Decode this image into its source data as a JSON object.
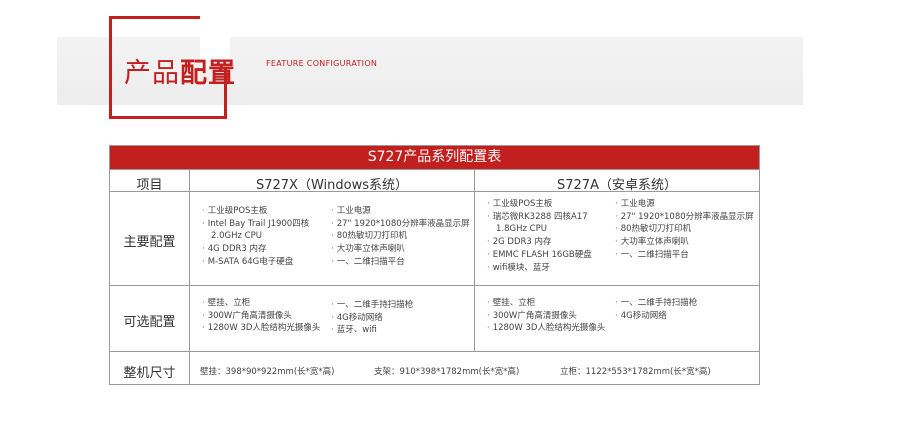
{
  "header": {
    "title_light": "产品",
    "title_bold": "配置",
    "subtitle_en": "FEATURE CONFIGURATION"
  },
  "table": {
    "title": "S727产品系列配置表",
    "col_item": "项目",
    "col_windows": "S727X（Windows系统）",
    "col_android": "S727A（安卓系统）",
    "row_main": "主要配置",
    "row_optional": "可选配置",
    "row_size": "整机尺寸",
    "win_main_left": [
      "工业级POS主板",
      "Intel Bay Trail J1900四核",
      "2.0GHz CPU",
      "4G DDR3 内存",
      "M-SATA 64G电子硬盘"
    ],
    "win_main_right": [
      "工业电源",
      "27\" 1920*1080分辨率液晶显示屏",
      "80热敏切刀打印机",
      "大功率立体声喇叭",
      "一、二维扫描平台"
    ],
    "and_main_left": [
      "工业级POS主板",
      "瑞芯微RK3288 四核A17",
      "1.8GHz CPU",
      "2G DDR3 内存",
      "EMMC FLASH 16GB硬盘",
      "wifi模块、蓝牙"
    ],
    "and_main_right": [
      "工业电源",
      "27\" 1920*1080分辨率液晶显示屏",
      "80热敏切刀打印机",
      "大功率立体声喇叭",
      "一、二维扫描平台"
    ],
    "win_opt_left": [
      "壁挂、立柜",
      "300W广角高清摄像头",
      "1280W 3D人脸结构光摄像头"
    ],
    "win_opt_right": [
      "一、二维手持扫描枪",
      "4G移动网络",
      "蓝牙、wifi"
    ],
    "and_opt_left": [
      "壁挂、立柜",
      "300W广角高清摄像头",
      "1280W 3D人脸结构光摄像头"
    ],
    "and_opt_right": [
      "一、二维手持扫描枪",
      "4G移动网络"
    ],
    "size_wall": "壁挂：398*90*922mm(长*宽*高)",
    "size_stand": "支架：910*398*1782mm(长*宽*高)",
    "size_cabinet": "立柜：1122*553*1782mm(长*宽*高)"
  }
}
